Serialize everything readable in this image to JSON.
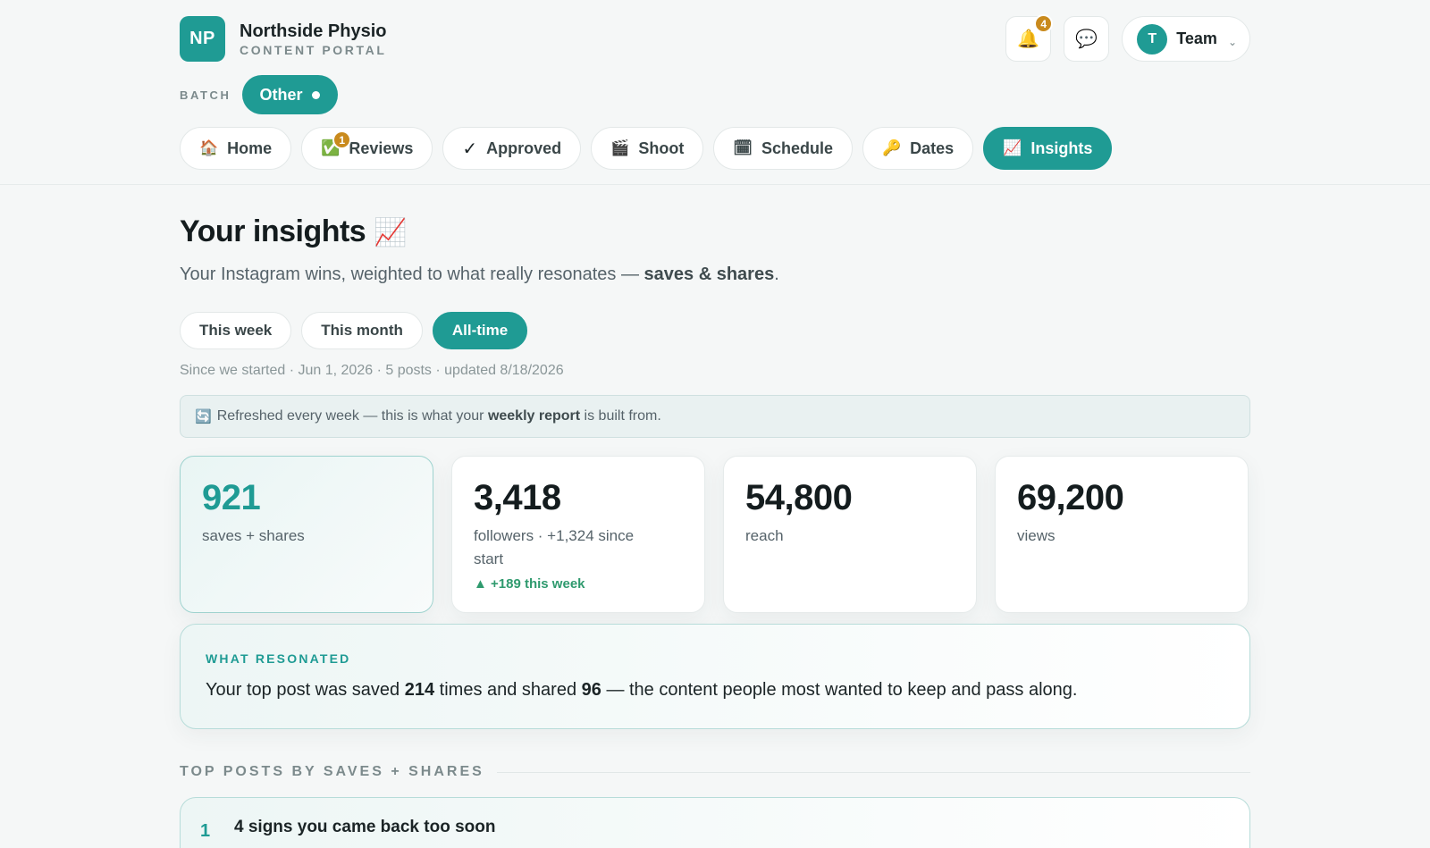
{
  "brand": {
    "initials": "NP",
    "name": "Northside Physio",
    "subtitle": "CONTENT PORTAL"
  },
  "header": {
    "notifications_count": "4",
    "team_initial": "T",
    "team_label": "Team",
    "team_caret": "⌄"
  },
  "batch": {
    "label": "BATCH",
    "value": "Other"
  },
  "nav": {
    "tabs": [
      {
        "icon": "🏠",
        "label": "Home"
      },
      {
        "icon": "✅",
        "label": "Reviews",
        "badge": "1"
      },
      {
        "icon": "✓",
        "label": "Approved"
      },
      {
        "icon": "🎬",
        "label": "Shoot"
      },
      {
        "icon": "🗓",
        "label": "Schedule"
      },
      {
        "icon": "🔑",
        "label": "Dates"
      },
      {
        "icon": "📈",
        "label": "Insights",
        "active": true
      }
    ]
  },
  "page": {
    "title": "Your insights",
    "title_icon": "📈",
    "subtitle_prefix": "Your Instagram wins, weighted to what really resonates — ",
    "subtitle_bold": "saves & shares",
    "subtitle_suffix": "."
  },
  "range": {
    "options": [
      "This week",
      "This month",
      "All-time"
    ],
    "selected": "All-time"
  },
  "meta": "Since we started · Jun 1, 2026 · 5 posts · updated 8/18/2026",
  "notice": {
    "icon": "🔄",
    "prefix": "Refreshed every week — this is what your ",
    "bold": "weekly report",
    "suffix": " is built from."
  },
  "stats": [
    {
      "value": "921",
      "label": "saves + shares"
    },
    {
      "value": "3,418",
      "label": "followers · +1,324 since start",
      "delta": "▲ +189 this week"
    },
    {
      "value": "54,800",
      "label": "reach"
    },
    {
      "value": "69,200",
      "label": "views"
    }
  ],
  "resonated": {
    "label": "WHAT RESONATED",
    "t1": "Your top post was saved ",
    "saved": "214",
    "t2": " times and shared ",
    "shared": "96",
    "t3": " — the content people most wanted to keep and pass along."
  },
  "top_posts": {
    "heading": "TOP POSTS BY SAVES + SHARES",
    "items": [
      {
        "rank": "1",
        "title": "4 signs you came back too soon"
      }
    ]
  },
  "colors": {
    "accent": "#1f9b94",
    "badge": "#c98a1d",
    "positive": "#2f9a6e"
  }
}
